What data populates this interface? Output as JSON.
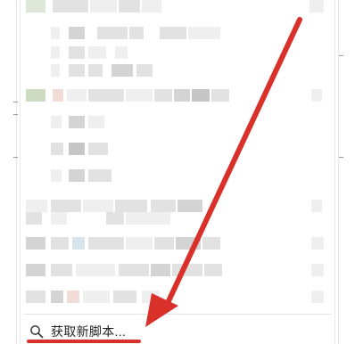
{
  "menu": {
    "footer": {
      "icon": "search-icon",
      "label": "获取新脚本..."
    }
  },
  "annotation": {
    "arrow_color": "#d9302a",
    "highlight_color": "#d9302a"
  }
}
